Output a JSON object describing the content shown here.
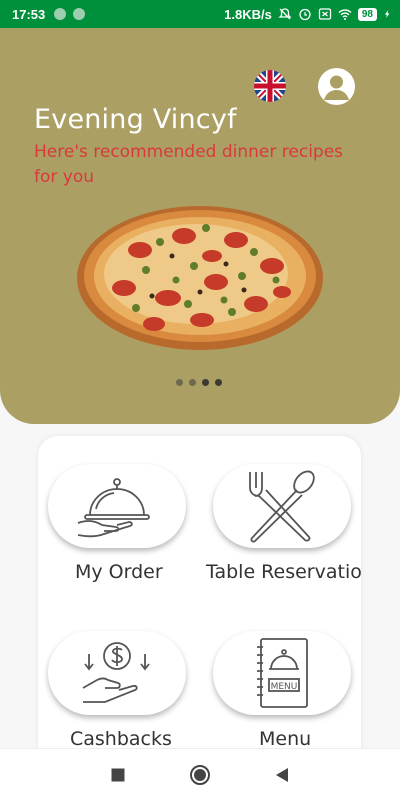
{
  "status_bar": {
    "time": "17:53",
    "network_speed": "1.8KB/s",
    "battery": "98"
  },
  "hero": {
    "greeting": "Evening Vincyf",
    "subtitle": "Here's recommended dinner recipes for you",
    "carousel_total": 4,
    "carousel_active": 2
  },
  "menu": {
    "items": [
      {
        "label": "My Order",
        "icon": "serving-cloche-icon"
      },
      {
        "label": "Table Reservatio",
        "icon": "fork-spoon-icon"
      },
      {
        "label": "Cashbacks",
        "icon": "cashback-hand-icon"
      },
      {
        "label": "Menu",
        "icon": "menu-book-icon"
      }
    ]
  },
  "colors": {
    "status_bar": "#008f3a",
    "hero_bg": "#ab9f64",
    "subtitle": "#d83a3a"
  }
}
